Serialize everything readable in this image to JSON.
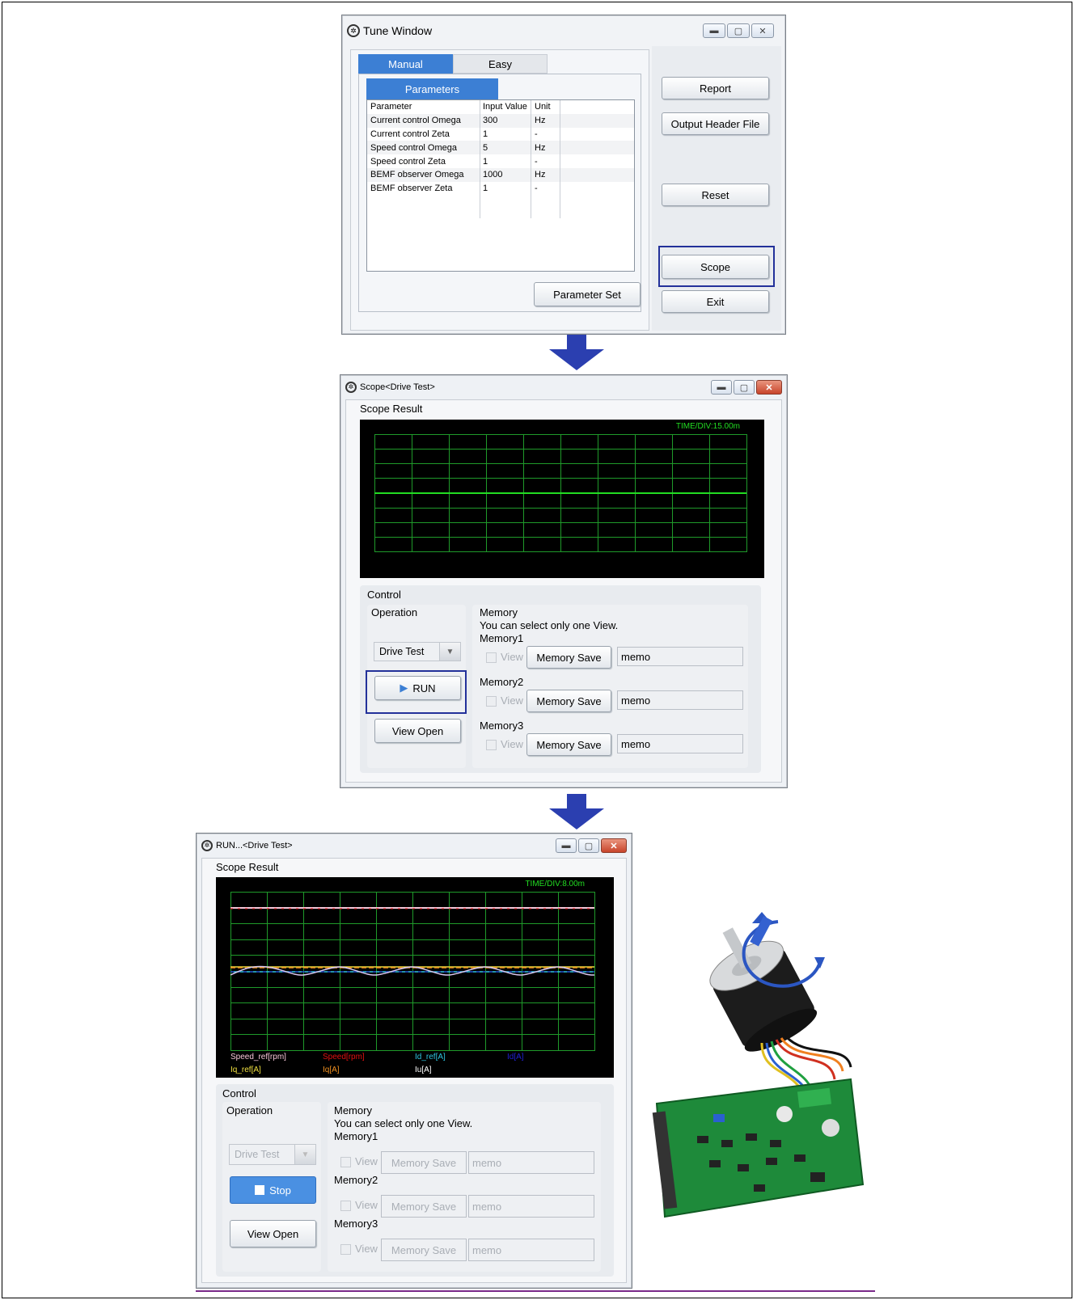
{
  "tune_window": {
    "title": "Tune Window",
    "tabs": [
      "Manual",
      "Easy"
    ],
    "sub_tab": "Parameters",
    "table_headers": [
      "Parameter",
      "Input Value",
      "Unit"
    ],
    "rows": [
      {
        "param": "Current control Omega",
        "value": "300",
        "unit": "Hz"
      },
      {
        "param": "Current control Zeta",
        "value": "1",
        "unit": "-"
      },
      {
        "param": "Speed control Omega",
        "value": "5",
        "unit": "Hz"
      },
      {
        "param": "Speed control Zeta",
        "value": "1",
        "unit": "-"
      },
      {
        "param": "BEMF observer Omega",
        "value": "1000",
        "unit": "Hz"
      },
      {
        "param": "BEMF observer Zeta",
        "value": "1",
        "unit": "-"
      }
    ],
    "buttons": {
      "parameter_set": "Parameter Set",
      "report": "Report",
      "output_header": "Output Header File",
      "reset": "Reset",
      "scope": "Scope",
      "exit": "Exit"
    }
  },
  "scope_window": {
    "title": "Scope<Drive Test>",
    "result_label": "Scope Result",
    "time_div": "TIME/DIV:15.00m",
    "control_label": "Control",
    "operation_label": "Operation",
    "operation_value": "Drive Test",
    "run_button": "RUN",
    "view_open_button": "View Open",
    "memory_label": "Memory",
    "memory_note": "You can select only one View.",
    "memories": [
      {
        "name": "Memory1",
        "view": "View",
        "save": "Memory Save",
        "memo": "memo"
      },
      {
        "name": "Memory2",
        "view": "View",
        "save": "Memory Save",
        "memo": "memo"
      },
      {
        "name": "Memory3",
        "view": "View",
        "save": "Memory Save",
        "memo": "memo"
      }
    ]
  },
  "run_window": {
    "title": "RUN...<Drive Test>",
    "result_label": "Scope Result",
    "time_div": "TIME/DIV:8.00m",
    "legend": [
      {
        "name": "Speed_ref[rpm]",
        "color": "#f6c6d8"
      },
      {
        "name": "Speed[rpm]",
        "color": "#e01010"
      },
      {
        "name": "Id_ref[A]",
        "color": "#2ec4e0"
      },
      {
        "name": "Id[A]",
        "color": "#2020d0"
      },
      {
        "name": "Iq_ref[A]",
        "color": "#f0e040"
      },
      {
        "name": "Iq[A]",
        "color": "#f09020"
      },
      {
        "name": "Iu[A]",
        "color": "#ffffff"
      }
    ],
    "control_label": "Control",
    "operation_label": "Operation",
    "operation_value": "Drive Test",
    "stop_button": "Stop",
    "view_open_button": "View Open",
    "memory_label": "Memory",
    "memory_note": "You can select only one View.",
    "memories": [
      {
        "name": "Memory1",
        "view": "View",
        "save": "Memory Save",
        "memo": "memo"
      },
      {
        "name": "Memory2",
        "view": "View",
        "save": "Memory Save",
        "memo": "memo"
      },
      {
        "name": "Memory3",
        "view": "View",
        "save": "Memory Save",
        "memo": "memo"
      }
    ]
  },
  "colors": {
    "accent_blue": "#3c5fcc",
    "highlight_border": "#23319a",
    "grid_green": "#1f9a2a",
    "trace_green": "#22dd22",
    "stop_button": "#4a90e2"
  }
}
